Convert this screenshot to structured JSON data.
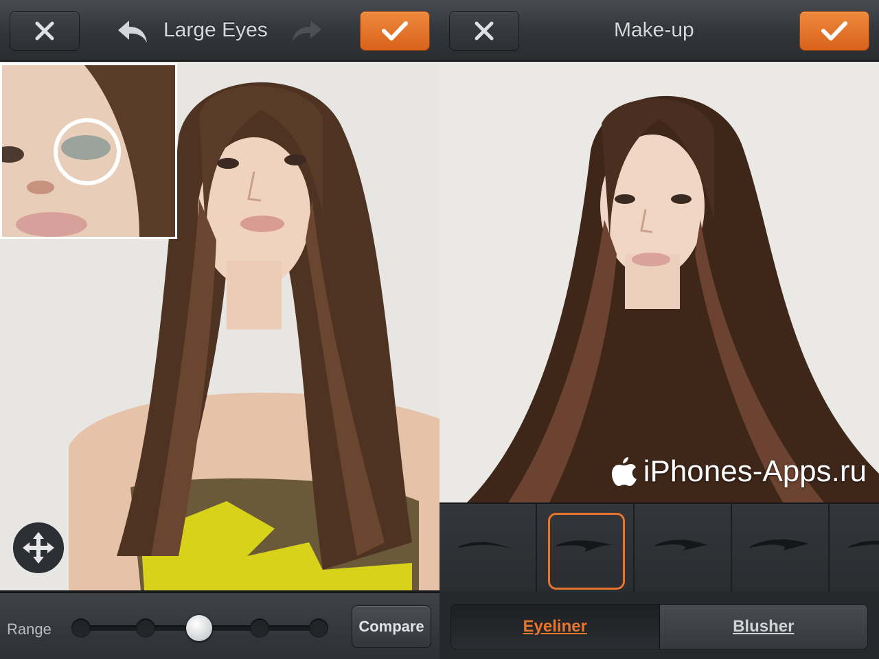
{
  "left": {
    "title": "Large Eyes",
    "close_icon": "close-icon",
    "undo_icon": "undo-icon",
    "redo_icon": "redo-icon",
    "confirm_icon": "checkmark-icon",
    "move_icon": "move-icon",
    "range_label": "Range",
    "range_value_fraction": 0.5,
    "compare_label": "Compare"
  },
  "right": {
    "title": "Make-up",
    "close_icon": "close-icon",
    "confirm_icon": "checkmark-icon",
    "styles": [
      "eyeliner-style-1",
      "eyeliner-style-2",
      "eyeliner-style-3",
      "eyeliner-style-4",
      "eyeliner-style-5"
    ],
    "selected_style_index": 1,
    "tabs": [
      {
        "label": "Eyeliner",
        "active": true
      },
      {
        "label": "Blusher",
        "active": false
      }
    ],
    "watermark": "iPhones-Apps.ru",
    "watermark_icon": "apple-logo-icon"
  },
  "colors": {
    "accent": "#e8752c",
    "toolbar": "#33363b"
  }
}
